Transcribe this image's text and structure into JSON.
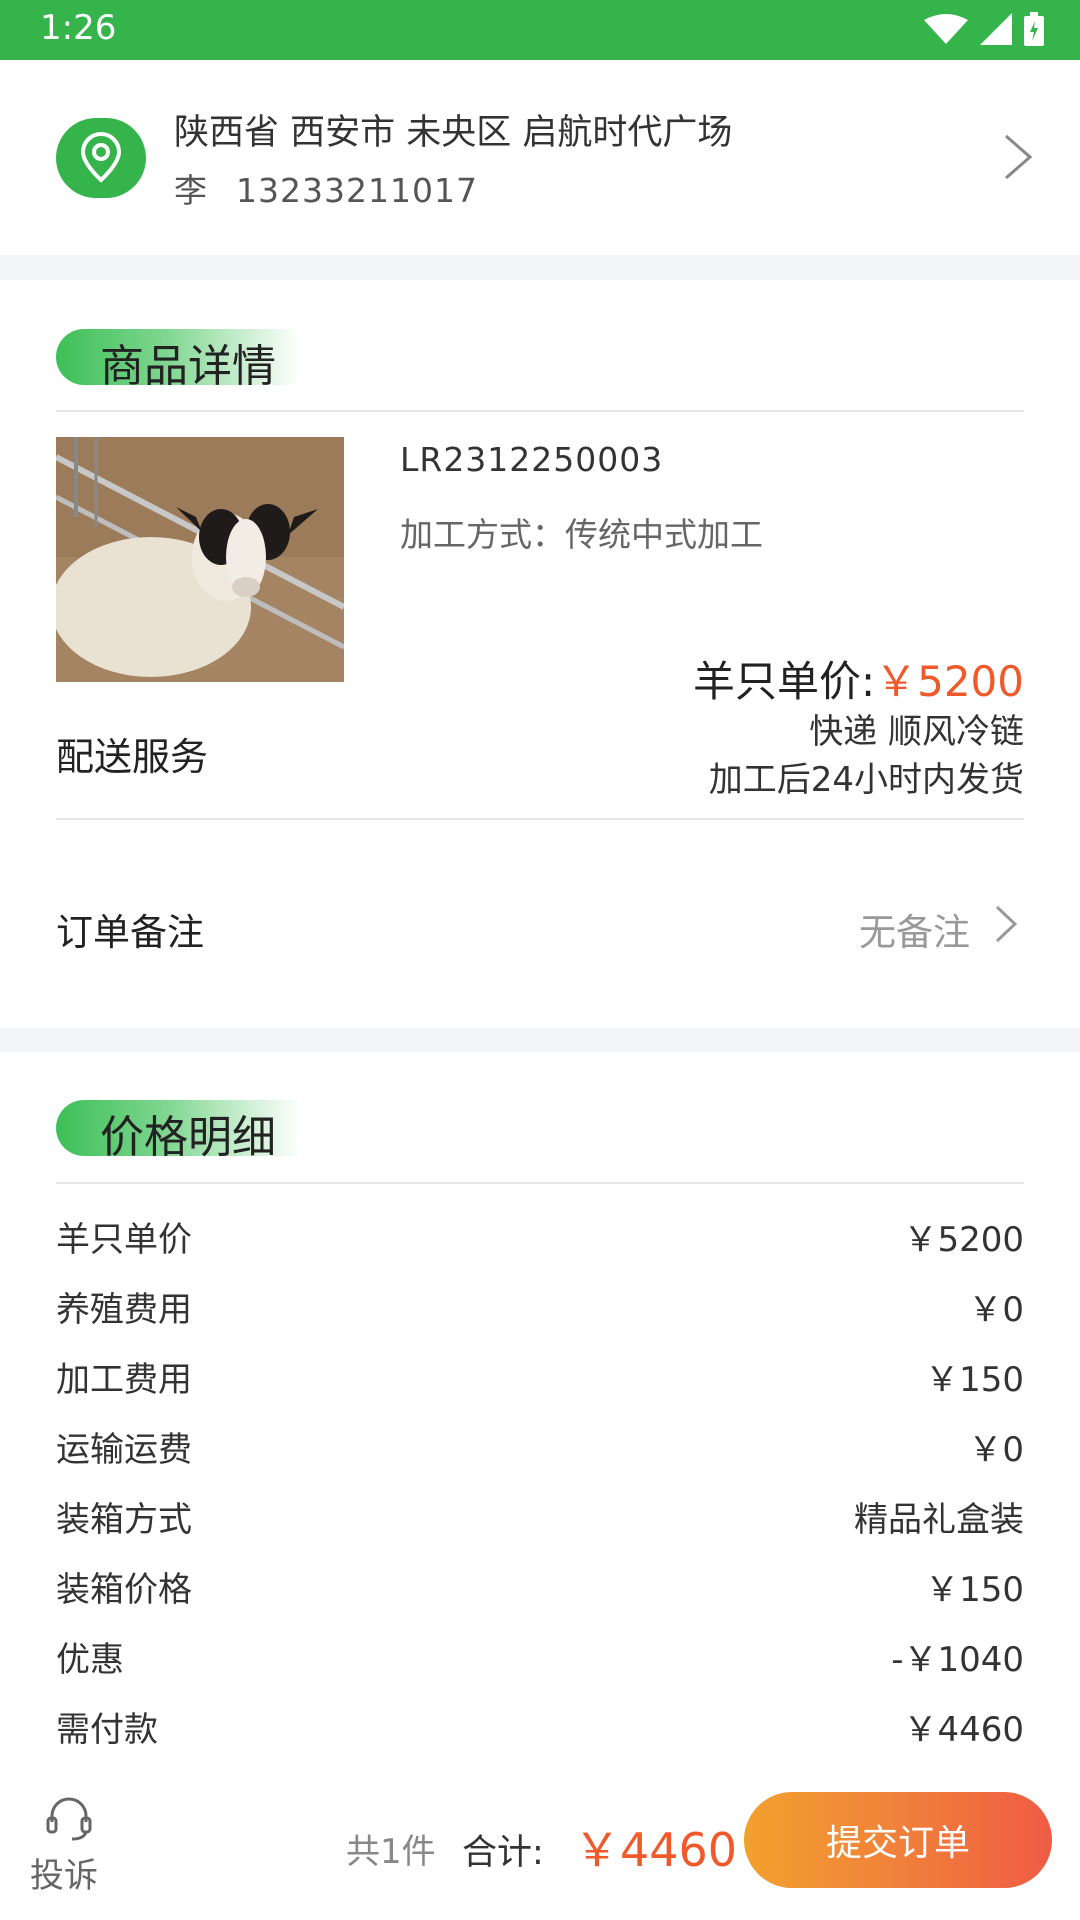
{
  "status_bar": {
    "time": "1:26"
  },
  "address": {
    "line1": "陕西省 西安市 未央区 启航时代广场",
    "name": "李",
    "phone": "13233211017"
  },
  "product_section": {
    "title": "商品详情",
    "code": "LR2312250003",
    "method": "加工方式：传统中式加工",
    "unit_price_label": "羊只单价:",
    "unit_price_value": "￥5200",
    "delivery_label": "配送服务",
    "delivery_line1": "快递   顺风冷链",
    "delivery_line2": "加工后24小时内发货"
  },
  "remark": {
    "label": "订单备注",
    "value": "无备注"
  },
  "price_section": {
    "title": "价格明细",
    "rows": [
      {
        "label": "羊只单价",
        "value": "￥5200"
      },
      {
        "label": "养殖费用",
        "value": "￥0"
      },
      {
        "label": "加工费用",
        "value": "￥150"
      },
      {
        "label": "运输运费",
        "value": "￥0"
      },
      {
        "label": "装箱方式",
        "value": "精品礼盒装"
      },
      {
        "label": "装箱价格",
        "value": "￥150"
      },
      {
        "label": "优惠",
        "value": "-￥1040"
      },
      {
        "label": "需付款",
        "value": "￥4460"
      }
    ]
  },
  "bottom_bar": {
    "complain_label": "投诉",
    "count_text": "共1件",
    "total_label": "合计:",
    "total_value": "￥4460",
    "submit_label": "提交订单"
  },
  "colors": {
    "brand_green": "#34b44a",
    "price_red": "#f05a2a",
    "button_orange": "#f07a3c"
  },
  "icons": [
    "wifi-icon",
    "signal-icon",
    "battery-icon",
    "location-pin-icon",
    "chevron-right-icon",
    "headset-icon"
  ]
}
